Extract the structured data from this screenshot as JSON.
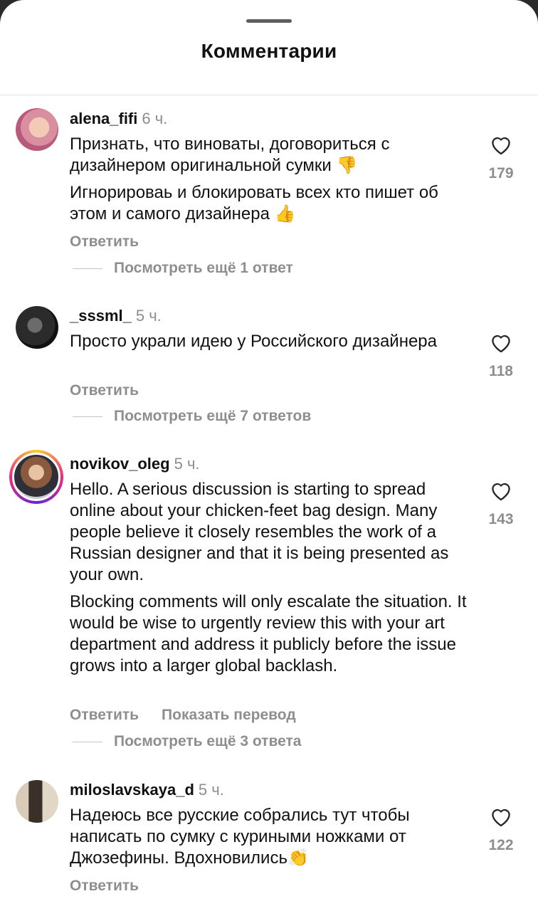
{
  "header": {
    "title": "Комментарии"
  },
  "comments": [
    {
      "username": "alena_fifi",
      "time": "6 ч.",
      "paragraphs": [
        "Признать, что виноваты, договориться с дизайнером оригинальной сумки 👎",
        "Игнорироваь и блокировать всех кто пишет об этом и самого дизайнера 👍"
      ],
      "reply_label": "Ответить",
      "likes": "179",
      "view_replies": "Посмотреть ещё 1 ответ",
      "avatar_icon": "profile-photo-avatar"
    },
    {
      "username": "_sssml_",
      "time": "5 ч.",
      "paragraphs": [
        "Просто украли идею у Российского дизайнера"
      ],
      "reply_label": "Ответить",
      "likes": "118",
      "view_replies": "Посмотреть ещё 7 ответов",
      "avatar_icon": "profile-photo-avatar"
    },
    {
      "username": "novikov_oleg",
      "time": "5 ч.",
      "paragraphs": [
        "Hello. A serious discussion is starting to spread online about your chicken-feet bag design. Many people believe it closely resembles the work of a Russian designer and that it is being presented as your own.",
        "Blocking comments will only escalate the situation. It would be wise to urgently review this with your art department and address it publicly before the issue grows into a larger global backlash."
      ],
      "reply_label": "Ответить",
      "translate_label": "Показать перевод",
      "likes": "143",
      "view_replies": "Посмотреть ещё 3 ответа",
      "avatar_icon": "story-ring-avatar"
    },
    {
      "username": "miloslavskaya_d",
      "time": "5 ч.",
      "paragraphs": [
        "Надеюсь все русские собрались тут чтобы написать по сумку с куриными ножками от Джозефины. Вдохновились👏"
      ],
      "reply_label": "Ответить",
      "likes": "122",
      "avatar_icon": "profile-photo-avatar"
    }
  ],
  "colors": {
    "text": "#111111",
    "secondary": "#8e8e8e",
    "background": "#ffffff"
  }
}
